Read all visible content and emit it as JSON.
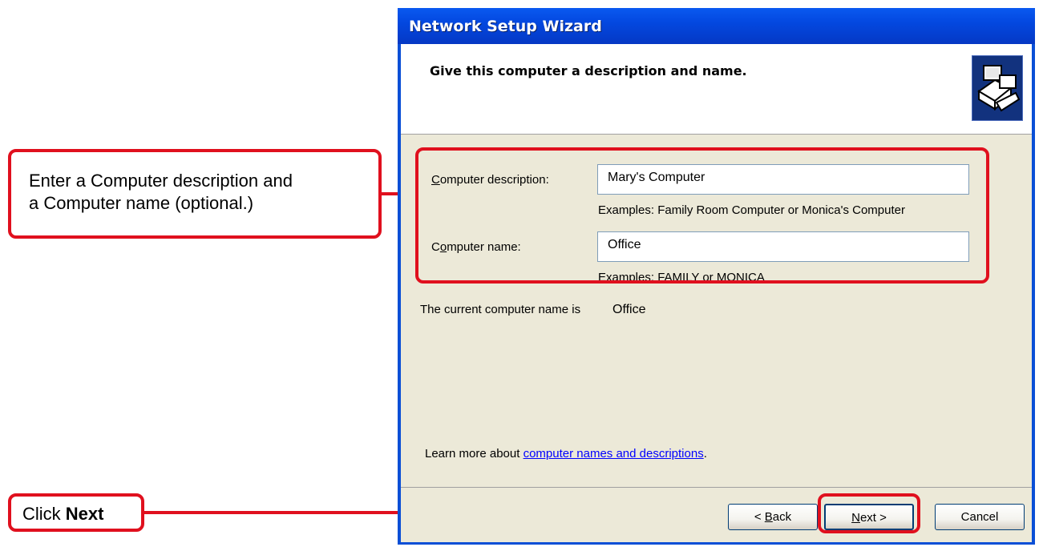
{
  "window": {
    "title": "Network Setup Wizard",
    "header_title": "Give this computer a description and name."
  },
  "form": {
    "description_label_first": "C",
    "description_label_rest": "omputer description:",
    "description_value": "Mary's Computer",
    "description_example": "Examples: Family Room Computer or Monica's Computer",
    "name_label_first": "C",
    "name_label_u": "o",
    "name_label_rest": "mputer name:",
    "name_value": "Office",
    "name_example": "Examples: FAMILY or MONICA",
    "current_name_text": "The current computer name is",
    "current_name_value": "Office"
  },
  "learn_more": {
    "prefix": "Learn more about ",
    "link": "computer names and descriptions",
    "suffix": "."
  },
  "buttons": {
    "back_prefix": "< ",
    "back_u": "B",
    "back_rest": "ack",
    "next_u": "N",
    "next_rest": "ext >",
    "cancel": "Cancel"
  },
  "callouts": {
    "description_line1": "Enter a Computer description and",
    "description_line2": "a Computer name (optional.)",
    "next_prefix": "Click ",
    "next_bold": "Next"
  },
  "colors": {
    "accent": "#e0101e",
    "titlebar": "#0348e0",
    "dialog_bg": "#ece9d8"
  }
}
